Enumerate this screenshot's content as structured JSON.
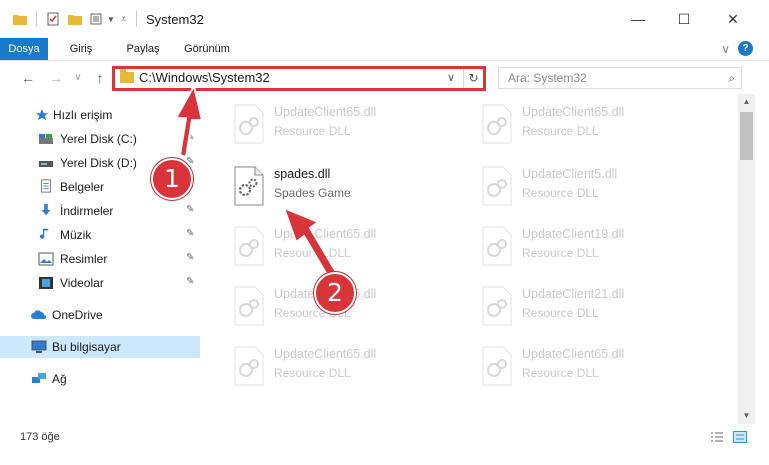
{
  "window": {
    "title": "System32",
    "minimize_glyph": "—",
    "maximize_glyph": "☐",
    "close_glyph": "✕"
  },
  "ribbon": {
    "tabs": [
      "Dosya",
      "Giriş",
      "Paylaş",
      "Görünüm"
    ],
    "expand_glyph": "∨",
    "help_glyph": "?"
  },
  "nav": {
    "back_glyph": "←",
    "forward_glyph": "→",
    "recent_glyph": "∨",
    "up_glyph": "↑"
  },
  "address": {
    "path": "C:\\Windows\\System32",
    "dropdown_glyph": "∨",
    "refresh_glyph": "↻"
  },
  "search": {
    "placeholder": "Ara: System32",
    "icon": "search-icon",
    "glyph": "⌕"
  },
  "sidebar": {
    "items": [
      {
        "label": "Hızlı erişim",
        "icon": "star-icon"
      },
      {
        "label": "Yerel Disk (C:)",
        "icon": "drive-icon",
        "pinned": true
      },
      {
        "label": "Yerel Disk (D:)",
        "icon": "drive-icon",
        "pinned": true
      },
      {
        "label": "Belgeler",
        "icon": "documents-icon",
        "pinned": true
      },
      {
        "label": "İndirmeler",
        "icon": "download-icon",
        "pinned": true
      },
      {
        "label": "Müzik",
        "icon": "music-icon",
        "pinned": true
      },
      {
        "label": "Resimler",
        "icon": "pictures-icon",
        "pinned": true
      },
      {
        "label": "Videolar",
        "icon": "videos-icon",
        "pinned": true
      },
      {
        "label": "OneDrive",
        "icon": "cloud-icon"
      },
      {
        "label": "Bu bilgisayar",
        "icon": "computer-icon",
        "selected": true
      },
      {
        "label": "Ağ",
        "icon": "network-icon"
      }
    ],
    "pin_glyph": "📌"
  },
  "files": [
    {
      "name": "UpdateClient65.dll",
      "type": "Resource DLL",
      "state": "faded"
    },
    {
      "name": "UpdateClient65.dll",
      "type": "Resource DLL",
      "state": "faded"
    },
    {
      "name": "spades.dll",
      "type": "Spades Game",
      "state": "active"
    },
    {
      "name": "UpdateClient5.dll",
      "type": "Resource DLL",
      "state": "faded"
    },
    {
      "name": "UpdateClient65.dll",
      "type": "Resource DLL",
      "state": "faded"
    },
    {
      "name": "UpdateClient19.dll",
      "type": "Resource DLL",
      "state": "faded"
    },
    {
      "name": "UpdateClient65.dll",
      "type": "Resource DLL",
      "state": "faded"
    },
    {
      "name": "UpdateClient21.dll",
      "type": "Resource DLL",
      "state": "faded"
    },
    {
      "name": "UpdateClient65.dll",
      "type": "Resource DLL",
      "state": "faded"
    },
    {
      "name": "UpdateClient65.dll",
      "type": "Resource DLL",
      "state": "faded"
    },
    {
      "name": "UpdateClient65.dll",
      "type": "Resource DLL",
      "state": "faded"
    }
  ],
  "status": {
    "count": "173 öğe"
  },
  "callouts": [
    "1",
    "2"
  ],
  "colors": {
    "accent": "#1979ca",
    "highlight": "#d9343a",
    "selected_bg": "#cce8ff"
  }
}
